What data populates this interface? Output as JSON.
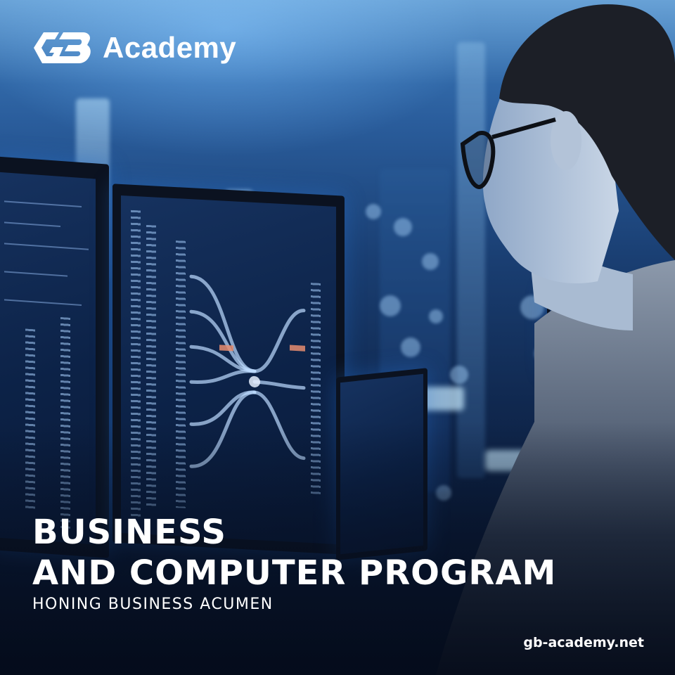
{
  "brand": {
    "logo_label": "GB",
    "name": "Academy",
    "primary_color": "#ffffff"
  },
  "headline": {
    "line1": "BUSINESS",
    "line2": "AND COMPUTER PROGRAM"
  },
  "subheadline": "HONING BUSINESS ACUMEN",
  "website": "gb-academy.net",
  "background": {
    "icon": "photo-woman-at-computer-monitors"
  }
}
